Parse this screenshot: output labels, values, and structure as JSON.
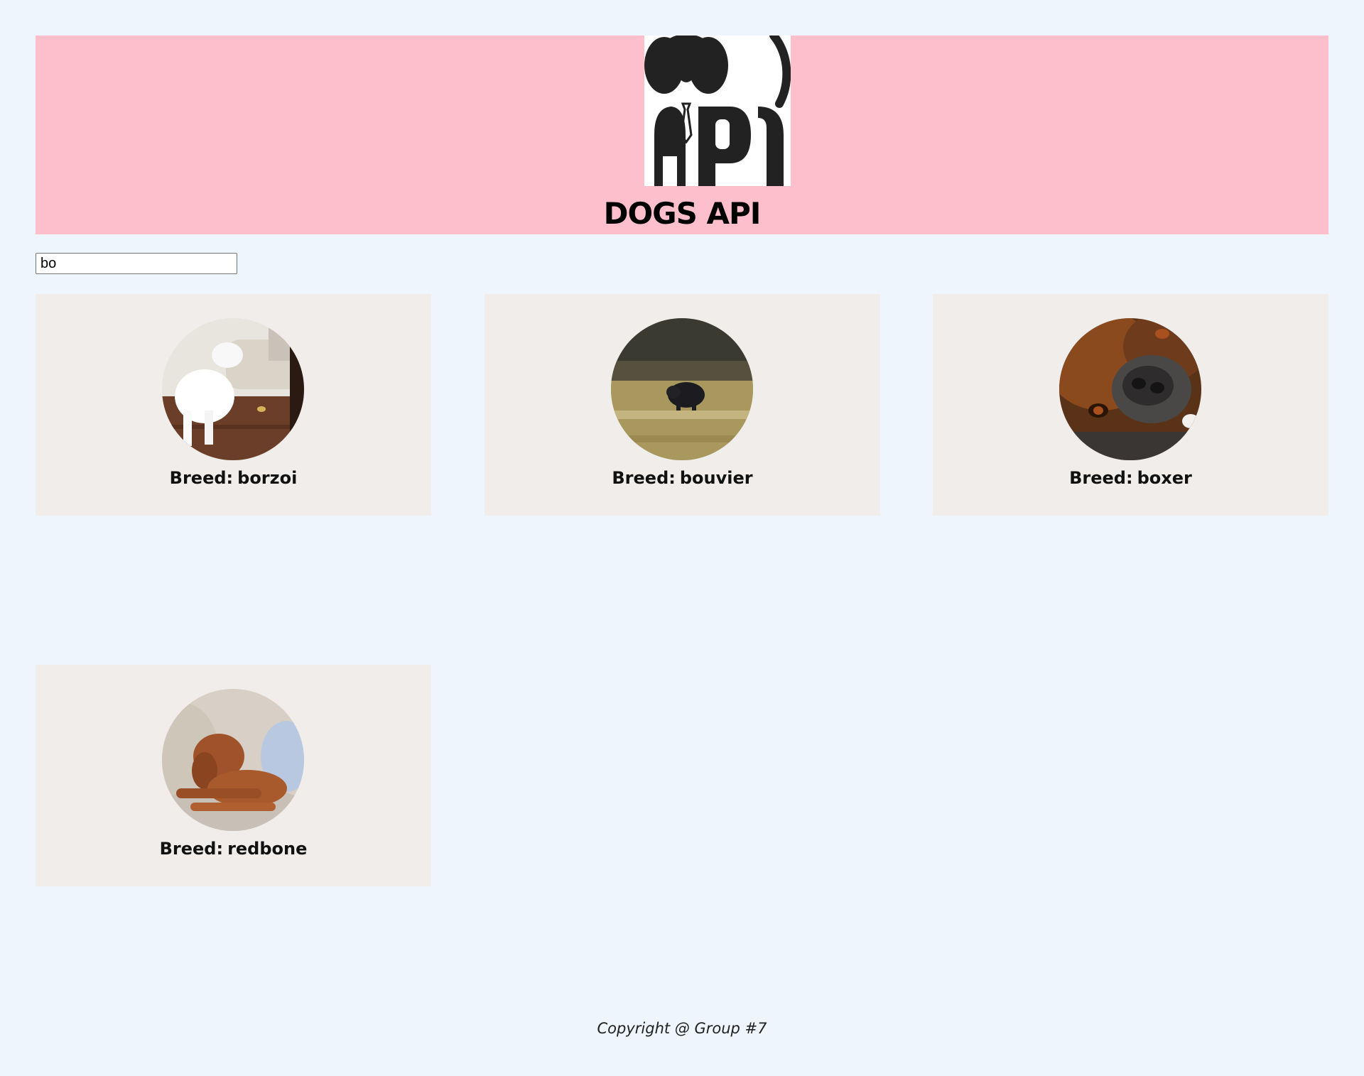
{
  "header": {
    "title": "DOGS API",
    "logo_icon": "dog-logo-icon",
    "logo_text": "API"
  },
  "search": {
    "value": "bo"
  },
  "cards": [
    {
      "prefix": "Breed:",
      "breed": "borzoi",
      "photo_icon": "white-dog-on-floor-photo"
    },
    {
      "prefix": "Breed:",
      "breed": "bouvier",
      "photo_icon": "black-dog-in-field-photo"
    },
    {
      "prefix": "Breed:",
      "breed": "boxer",
      "photo_icon": "boxer-face-closeup-photo"
    },
    {
      "prefix": "Breed:",
      "breed": "redbone",
      "photo_icon": "sleeping-red-dog-photo"
    }
  ],
  "footer": {
    "copyright": "Copyright @ Group #7"
  },
  "colors": {
    "page_background": "#eef5fd",
    "header_background": "#fdbfcc",
    "card_background": "#f0edeb"
  }
}
